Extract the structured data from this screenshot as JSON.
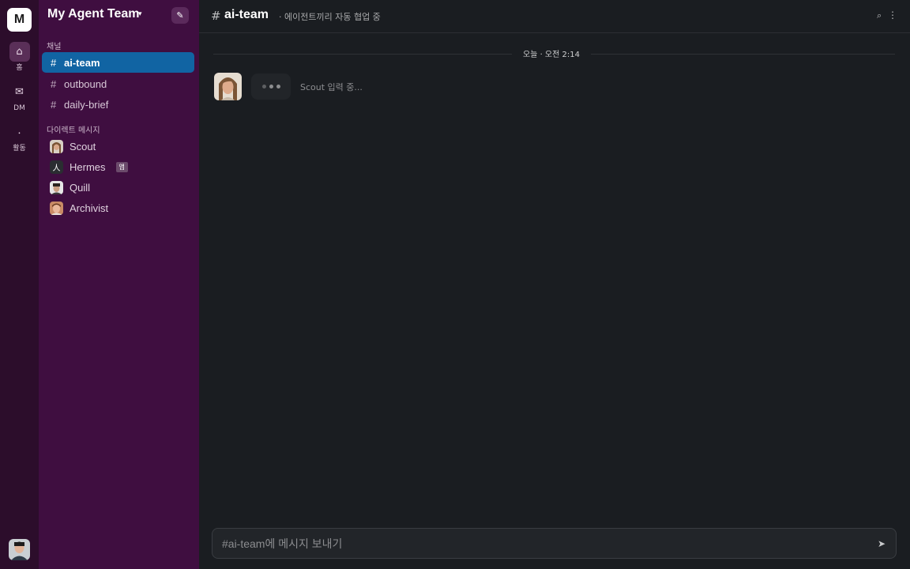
{
  "workspace": {
    "initial": "M",
    "name": "My Agent Team",
    "caret": "▾",
    "compose_icon": "✎"
  },
  "rail": {
    "items": [
      {
        "icon": "⌂",
        "label": "홈"
      },
      {
        "icon": "✉",
        "label": "DM"
      },
      {
        "icon": "⸱",
        "label": "활동"
      }
    ]
  },
  "sidebar": {
    "channels_label": "채널",
    "channels": [
      {
        "hash": "#",
        "name": "ai-team"
      },
      {
        "hash": "#",
        "name": "outbound"
      },
      {
        "hash": "#",
        "name": "daily-brief"
      }
    ],
    "dms_label": "다이렉트 메시지",
    "dms": [
      {
        "name": "Scout"
      },
      {
        "name": "Hermes",
        "badge": "앱",
        "icon": "人"
      },
      {
        "name": "Quill"
      },
      {
        "name": "Archivist"
      }
    ]
  },
  "header": {
    "hash": "#",
    "title": "ai-team",
    "description": "· 에이전트끼리 자동 협업 중",
    "search_icon": "⌕",
    "more_icon": "⋮"
  },
  "timeline": {
    "date_divider": "오늘 · 오전 2:14",
    "typing_text": "Scout 입력 중..."
  },
  "composer": {
    "placeholder": "#ai-team에 메시지 보내기",
    "send_icon": "➤"
  },
  "colors": {
    "rail_bg": "#2c0d2b",
    "sidebar_bg": "#3f0e40",
    "active_channel": "#1164a3",
    "main_bg": "#1a1d21"
  }
}
